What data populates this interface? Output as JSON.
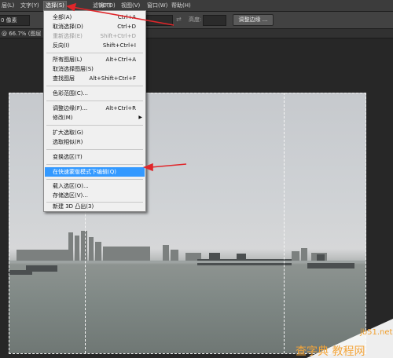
{
  "menubar": {
    "items": [
      {
        "label": "层(L)"
      },
      {
        "label": "文字(Y)"
      },
      {
        "label": "选择(S)"
      },
      {
        "label": "滤镜(T)"
      },
      {
        "label": "3D(D)"
      },
      {
        "label": "视图(V)"
      },
      {
        "label": "窗口(W)"
      },
      {
        "label": "帮助(H)"
      }
    ]
  },
  "options": {
    "feather_value": "0 像素",
    "height_label": "高度:",
    "refine_edge_button": "调整边缘 ..."
  },
  "document": {
    "tab_label": "@ 66.7% (图层 0"
  },
  "select_menu": {
    "items": [
      {
        "label": "全部(A)",
        "shortcut": "Ctrl+A"
      },
      {
        "label": "取消选择(D)",
        "shortcut": "Ctrl+D"
      },
      {
        "label": "重新选择(E)",
        "shortcut": "Shift+Ctrl+D"
      },
      {
        "label": "反向(I)",
        "shortcut": "Shift+Ctrl+I"
      },
      {
        "label": "所有图层(L)",
        "shortcut": "Alt+Ctrl+A"
      },
      {
        "label": "取消选择图层(S)",
        "shortcut": ""
      },
      {
        "label": "查找图层",
        "shortcut": "Alt+Shift+Ctrl+F"
      },
      {
        "label": "色彩范围(C)...",
        "shortcut": ""
      },
      {
        "label": "调整边缘(F)...",
        "shortcut": "Alt+Ctrl+R"
      },
      {
        "label": "修改(M)",
        "shortcut": ""
      },
      {
        "label": "扩大选取(G)",
        "shortcut": ""
      },
      {
        "label": "选取相似(R)",
        "shortcut": ""
      },
      {
        "label": "变换选区(T)",
        "shortcut": ""
      },
      {
        "label": "在快速蒙版模式下编辑(Q)",
        "shortcut": ""
      },
      {
        "label": "载入选区(O)...",
        "shortcut": ""
      },
      {
        "label": "存储选区(V)...",
        "shortcut": ""
      },
      {
        "label": "新建 3D 凸出(3)",
        "shortcut": ""
      }
    ]
  },
  "watermark": {
    "site": "jb51.net",
    "text": "查字典 教程网"
  },
  "colors": {
    "highlight": "#3399ff",
    "arrow": "#e0262a"
  }
}
